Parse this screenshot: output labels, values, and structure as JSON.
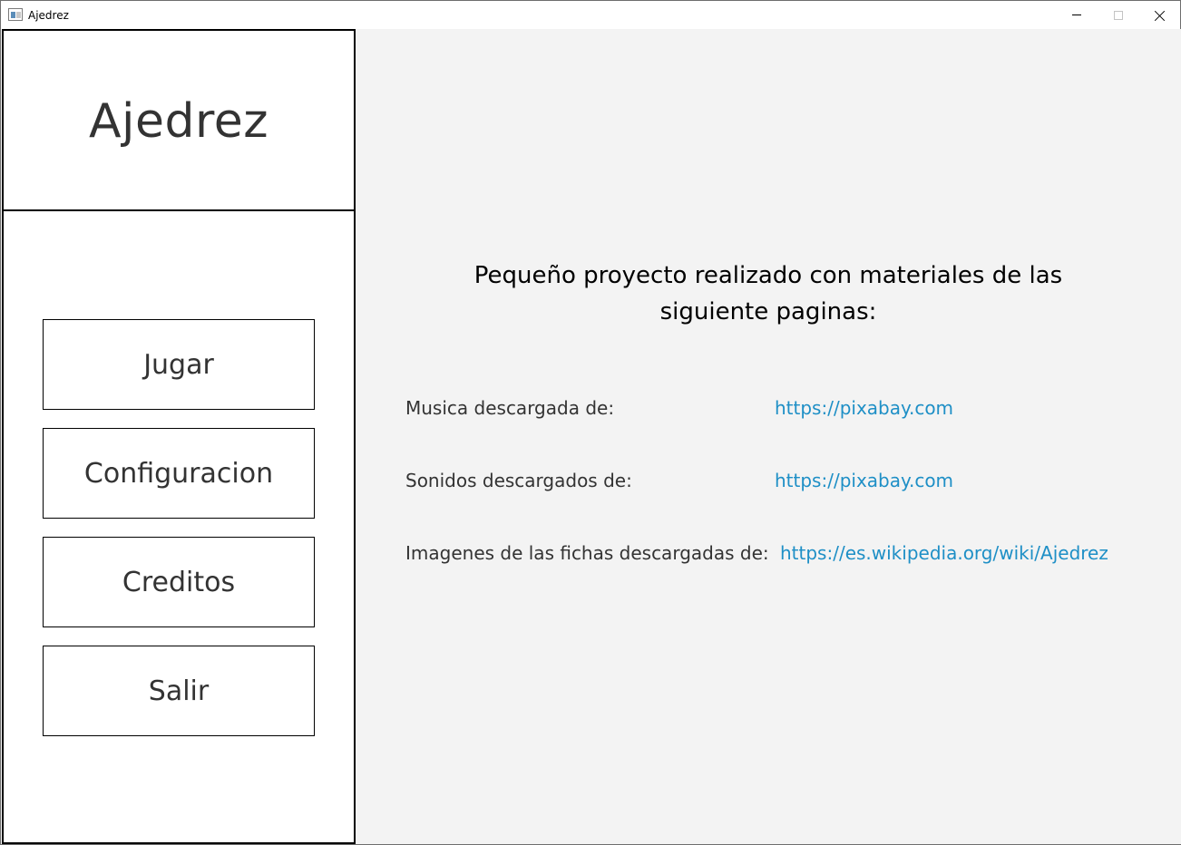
{
  "window": {
    "title": "Ajedrez"
  },
  "sidebar": {
    "title": "Ajedrez",
    "buttons": {
      "jugar": "Jugar",
      "configuracion": "Configuracion",
      "creditos": "Creditos",
      "salir": "Salir"
    }
  },
  "credits": {
    "headline": "Pequeño proyecto realizado con materiales de las siguiente paginas:",
    "rows": [
      {
        "label": "Musica descargada de:",
        "link": "https://pixabay.com"
      },
      {
        "label": "Sonidos descargados de:",
        "link": "https://pixabay.com"
      },
      {
        "label": "Imagenes de las fichas descargadas de:",
        "link": "https://es.wikipedia.org/wiki/Ajedrez"
      }
    ]
  },
  "colors": {
    "link": "#1e8fc6",
    "content_bg": "#f3f3f3",
    "text": "#333333"
  }
}
